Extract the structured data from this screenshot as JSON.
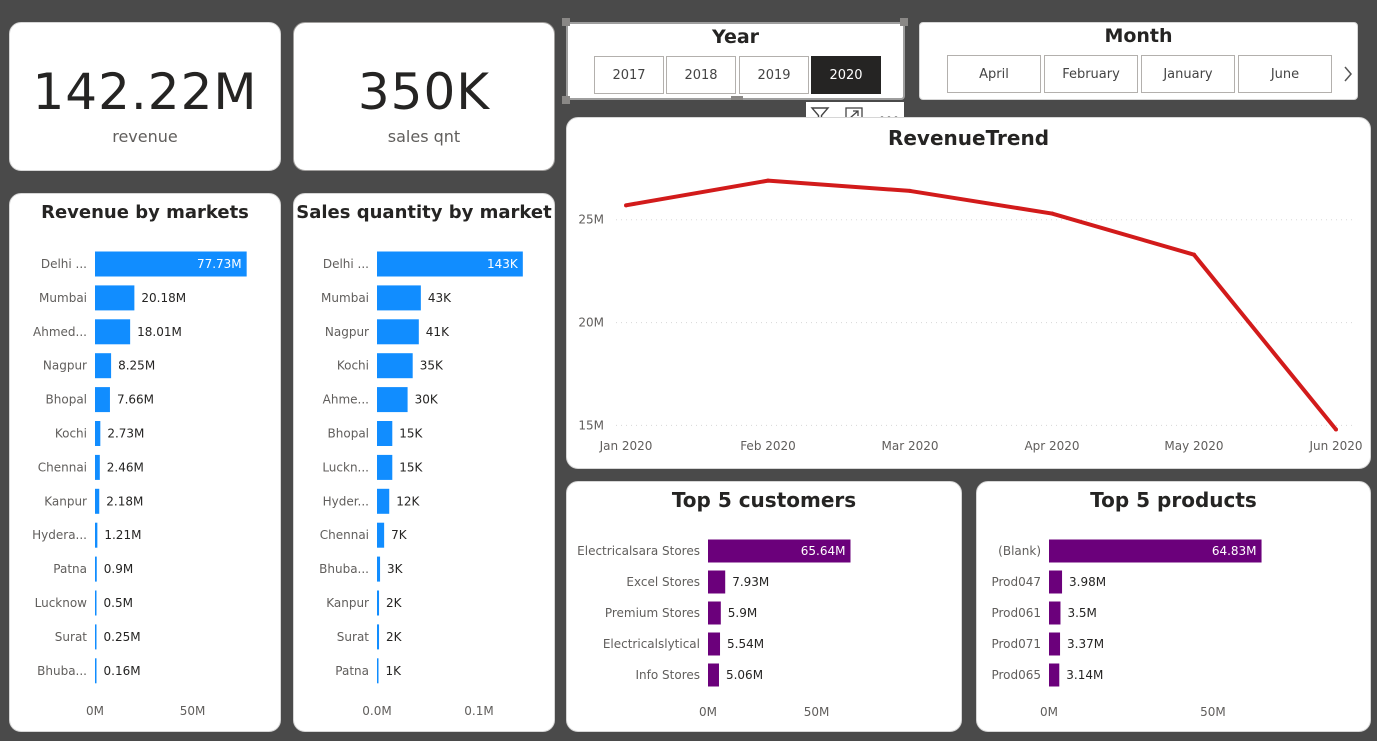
{
  "kpis": {
    "revenue": {
      "value": "142.22M",
      "label": "revenue"
    },
    "sales_qnt": {
      "value": "350K",
      "label": "sales qnt"
    }
  },
  "year_slicer": {
    "title": "Year",
    "options": [
      "2017",
      "2018",
      "2019",
      "2020"
    ],
    "selected": "2020"
  },
  "month_slicer": {
    "title": "Month",
    "options": [
      "April",
      "February",
      "January",
      "June"
    ],
    "next_icon": "chevron-right-icon"
  },
  "visual_header": {
    "icons": [
      "filter-icon",
      "focus-mode-icon",
      "more-options-icon"
    ]
  },
  "colors": {
    "blue": "#118DFF",
    "purple": "#6B007B",
    "red": "#D21B1B"
  },
  "chart_data": [
    {
      "id": "revenue_by_markets",
      "type": "bar",
      "orientation": "horizontal",
      "title": "Revenue by markets",
      "categories": [
        "Delhi ...",
        "Mumbai",
        "Ahmed...",
        "Nagpur",
        "Bhopal",
        "Kochi",
        "Chennai",
        "Kanpur",
        "Hydera...",
        "Patna",
        "Lucknow",
        "Surat",
        "Bhuba..."
      ],
      "values": [
        77.73,
        20.18,
        18.01,
        8.25,
        7.66,
        2.73,
        2.46,
        2.18,
        1.21,
        0.9,
        0.5,
        0.25,
        0.16
      ],
      "labels": [
        "77.73M",
        "20.18M",
        "18.01M",
        "8.25M",
        "7.66M",
        "2.73M",
        "2.46M",
        "2.18M",
        "1.21M",
        "0.9M",
        "0.5M",
        "0.25M",
        "0.16M"
      ],
      "xticks": [
        "0M",
        "50M"
      ],
      "xtick_values": [
        0,
        50
      ],
      "xlim": [
        0,
        82
      ],
      "color": "#118DFF"
    },
    {
      "id": "sales_qty_by_market",
      "type": "bar",
      "orientation": "horizontal",
      "title": "Sales quantity by market",
      "categories": [
        "Delhi ...",
        "Mumbai",
        "Nagpur",
        "Kochi",
        "Ahme...",
        "Bhopal",
        "Luckn...",
        "Hyder...",
        "Chennai",
        "Bhuba...",
        "Kanpur",
        "Surat",
        "Patna"
      ],
      "values": [
        143,
        43,
        41,
        35,
        30,
        15,
        15,
        12,
        7,
        3,
        2,
        2,
        1
      ],
      "labels": [
        "143K",
        "43K",
        "41K",
        "35K",
        "30K",
        "15K",
        "15K",
        "12K",
        "7K",
        "3K",
        "2K",
        "2K",
        "1K"
      ],
      "xticks": [
        "0.0M",
        "0.1M"
      ],
      "xtick_values": [
        0,
        100
      ],
      "xlim": [
        0,
        152
      ],
      "color": "#118DFF"
    },
    {
      "id": "revenue_trend",
      "type": "line",
      "title": "RevenueTrend",
      "x": [
        "Jan 2020",
        "Feb 2020",
        "Mar 2020",
        "Apr 2020",
        "May 2020",
        "Jun 2020"
      ],
      "values": [
        25.7,
        26.9,
        26.4,
        25.3,
        23.3,
        14.8
      ],
      "yticks": [
        "15M",
        "20M",
        "25M"
      ],
      "ytick_values": [
        15,
        20,
        25
      ],
      "ylim": [
        14.0,
        28.0
      ],
      "grid": true,
      "color": "#D21B1B"
    },
    {
      "id": "top5_customers",
      "type": "bar",
      "orientation": "horizontal",
      "title": "Top 5 customers",
      "categories": [
        "Electricalsara Stores",
        "Excel Stores",
        "Premium Stores",
        "Electricalslytical",
        "Info Stores"
      ],
      "values": [
        65.64,
        7.93,
        5.9,
        5.54,
        5.06
      ],
      "labels": [
        "65.64M",
        "7.93M",
        "5.9M",
        "5.54M",
        "5.06M"
      ],
      "xticks": [
        "0M",
        "50M"
      ],
      "xtick_values": [
        0,
        50
      ],
      "xlim": [
        0,
        82
      ],
      "color": "#6B007B"
    },
    {
      "id": "top5_products",
      "type": "bar",
      "orientation": "horizontal",
      "title": "Top 5 products",
      "categories": [
        "(Blank)",
        "Prod047",
        "Prod061",
        "Prod071",
        "Prod065"
      ],
      "values": [
        64.83,
        3.98,
        3.5,
        3.37,
        3.14
      ],
      "labels": [
        "64.83M",
        "3.98M",
        "3.5M",
        "3.37M",
        "3.14M"
      ],
      "xticks": [
        "0M",
        "50M"
      ],
      "xtick_values": [
        0,
        50
      ],
      "xlim": [
        0,
        79
      ],
      "color": "#6B007B"
    }
  ]
}
